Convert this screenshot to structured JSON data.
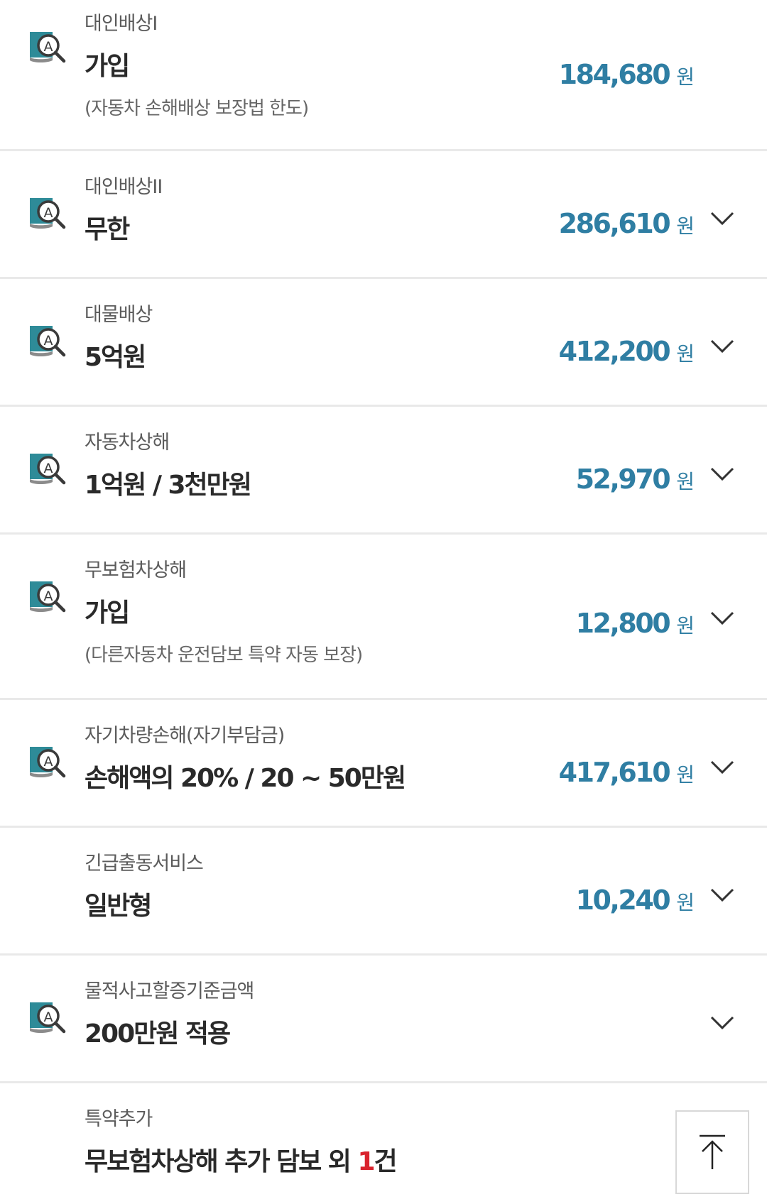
{
  "coverages": [
    {
      "category": "대인배상I",
      "value": "가입",
      "note": "(자동차 손해배상 보장법 한도)",
      "amount": "184,680",
      "unit": "원",
      "icon": "document-search-icon",
      "expandable": false
    },
    {
      "category": "대인배상II",
      "value": "무한",
      "note": "",
      "amount": "286,610",
      "unit": "원",
      "icon": "document-search-icon",
      "expandable": true
    },
    {
      "category": "대물배상",
      "value": "5억원",
      "note": "",
      "amount": "412,200",
      "unit": "원",
      "icon": "document-search-icon",
      "expandable": true
    },
    {
      "category": "자동차상해",
      "value": "1억원 / 3천만원",
      "note": "",
      "amount": "52,970",
      "unit": "원",
      "icon": "document-search-icon",
      "expandable": true
    },
    {
      "category": "무보험차상해",
      "value": "가입",
      "note": "(다른자동차 운전담보 특약 자동 보장)",
      "amount": "12,800",
      "unit": "원",
      "icon": "document-search-icon",
      "expandable": true
    },
    {
      "category": "자기차량손해(자기부담금)",
      "value": "손해액의 20% / 20 ~ 50만원",
      "note": "",
      "amount": "417,610",
      "unit": "원",
      "icon": "document-search-icon",
      "expandable": true
    },
    {
      "category": "긴급출동서비스",
      "value": "일반형",
      "note": "",
      "amount": "10,240",
      "unit": "원",
      "icon": "",
      "expandable": true
    },
    {
      "category": "물적사고할증기준금액",
      "value": "200만원 적용",
      "note": "",
      "amount": "",
      "unit": "",
      "icon": "document-search-icon",
      "expandable": true
    }
  ],
  "rider": {
    "category": "특약추가",
    "value_prefix": "무보험차상해 추가 담보 외 ",
    "value_count": "1",
    "value_suffix": "건"
  },
  "scroll_top": {
    "icon": "arrow-up-to-top-icon"
  },
  "colors": {
    "amount": "#2f7ea3",
    "highlight": "#d9232d",
    "icon_teal": "#2e8b98"
  }
}
